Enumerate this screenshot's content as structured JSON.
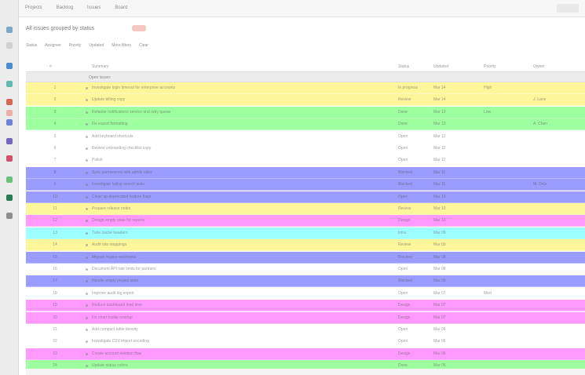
{
  "window": {
    "breadcrumb": [
      "Projects",
      "Backlog",
      "Issues",
      "Board"
    ],
    "title": "All issues grouped by status",
    "filters": [
      "Status",
      "Assignee",
      "Priority",
      "Updated",
      "More filters",
      "Clear"
    ]
  },
  "table": {
    "columns": [
      "#",
      "Summary",
      "Status",
      "Updated",
      "Priority",
      "Owner"
    ],
    "group_label": "Open issues",
    "rows": [
      {
        "num": "1",
        "summary": "Investigate login timeout for enterprise accounts",
        "status": "In progress",
        "updated": "Mar 14",
        "priority": "High",
        "owner": "",
        "color": "#fff59a"
      },
      {
        "num": "2",
        "summary": "Update billing copy",
        "status": "Review",
        "updated": "Mar 14",
        "priority": "",
        "owner": "J. Lane",
        "color": "#fff59a"
      },
      {
        "num": "3",
        "summary": "Refactor notifications service and retry queue",
        "status": "Done",
        "updated": "Mar 13",
        "priority": "Low",
        "owner": "",
        "color": "#9dff9d"
      },
      {
        "num": "4",
        "summary": "Fix export formatting",
        "status": "Done",
        "updated": "Mar 13",
        "priority": "",
        "owner": "A. Chen",
        "color": "#9dff9d"
      },
      {
        "num": "5",
        "summary": "Add keyboard shortcuts",
        "status": "Open",
        "updated": "Mar 12",
        "priority": "",
        "owner": "",
        "color": "#ffffff"
      },
      {
        "num": "6",
        "summary": "Review onboarding checklist copy",
        "status": "Open",
        "updated": "Mar 12",
        "priority": "",
        "owner": "",
        "color": "#ffffff"
      },
      {
        "num": "7",
        "summary": "Polish",
        "status": "Open",
        "updated": "Mar 12",
        "priority": "",
        "owner": "",
        "color": "#ffffff"
      },
      {
        "num": "8",
        "summary": "Sync permissions with admin roles",
        "status": "Blocked",
        "updated": "Mar 11",
        "priority": "",
        "owner": "",
        "color": "#9a9cff"
      },
      {
        "num": "9",
        "summary": "Investigate failing search tests",
        "status": "Blocked",
        "updated": "Mar 11",
        "priority": "",
        "owner": "M. Ortiz",
        "color": "#9a9cff"
      },
      {
        "num": "10",
        "summary": "Clean up deprecated feature flags",
        "status": "Open",
        "updated": "Mar 10",
        "priority": "",
        "owner": "",
        "color": "#9a9cff"
      },
      {
        "num": "11",
        "summary": "Prepare release notes",
        "status": "Review",
        "updated": "Mar 10",
        "priority": "",
        "owner": "",
        "color": "#fff59a"
      },
      {
        "num": "12",
        "summary": "Design empty state for reports",
        "status": "Design",
        "updated": "Mar 10",
        "priority": "",
        "owner": "",
        "color": "#ff99ff"
      },
      {
        "num": "13",
        "summary": "Tune cache headers",
        "status": "Infra",
        "updated": "Mar 09",
        "priority": "",
        "owner": "",
        "color": "#9dffff"
      },
      {
        "num": "14",
        "summary": "Audit role mappings",
        "status": "Review",
        "updated": "Mar 09",
        "priority": "",
        "owner": "",
        "color": "#fff59a"
      },
      {
        "num": "15",
        "summary": "Migrate legacy webhooks",
        "status": "Blocked",
        "updated": "Mar 08",
        "priority": "",
        "owner": "",
        "color": "#9a9cff"
      },
      {
        "num": "16",
        "summary": "Document API rate limits for partners",
        "status": "Open",
        "updated": "Mar 08",
        "priority": "",
        "owner": "",
        "color": "#ffffff"
      },
      {
        "num": "17",
        "summary": "Handle empty project state",
        "status": "Blocked",
        "updated": "Mar 08",
        "priority": "",
        "owner": "",
        "color": "#9a9cff"
      },
      {
        "num": "18",
        "summary": "Improve audit log export",
        "status": "Open",
        "updated": "Mar 07",
        "priority": "Med",
        "owner": "",
        "color": "#ffffff"
      },
      {
        "num": "19",
        "summary": "Reduce dashboard load time",
        "status": "Design",
        "updated": "Mar 07",
        "priority": "",
        "owner": "",
        "color": "#ff99ff"
      },
      {
        "num": "20",
        "summary": "Fix chart tooltip overlap",
        "status": "Design",
        "updated": "Mar 07",
        "priority": "",
        "owner": "",
        "color": "#ff99ff"
      },
      {
        "num": "21",
        "summary": "Add compact table density",
        "status": "Open",
        "updated": "Mar 06",
        "priority": "",
        "owner": "",
        "color": "#ffffff"
      },
      {
        "num": "22",
        "summary": "Investigate CSV import encoding",
        "status": "Open",
        "updated": "Mar 06",
        "priority": "",
        "owner": "",
        "color": "#ffffff"
      },
      {
        "num": "23",
        "summary": "Create account deletion flow",
        "status": "Design",
        "updated": "Mar 05",
        "priority": "",
        "owner": "",
        "color": "#ff99ff"
      },
      {
        "num": "24",
        "summary": "Update status colors",
        "status": "Done",
        "updated": "Mar 05",
        "priority": "",
        "owner": "",
        "color": "#9dff9d"
      }
    ]
  },
  "sidebar_colors": [
    "#7aa7c7",
    "#d0d0d0",
    "#4d8bd1",
    "#62b7b3",
    "#d7684f",
    "#e8b0a8",
    "#6c83d6",
    "#7466b8",
    "#cf4f6d",
    "#69c27a",
    "#2b7d58",
    "#8d8d8d"
  ]
}
